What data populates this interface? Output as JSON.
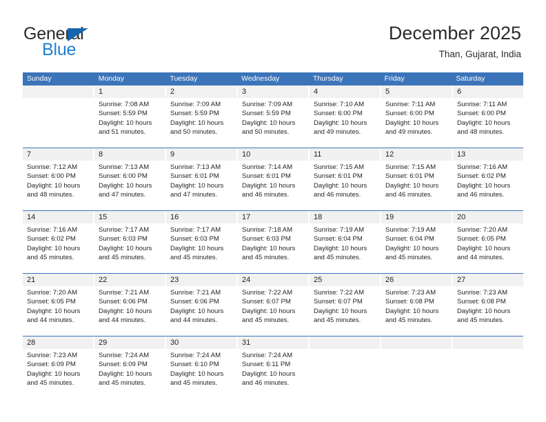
{
  "brand": {
    "name_top": "General",
    "name_bottom": "Blue",
    "accent_color": "#1f7fd0",
    "triangle_color": "#1565b0"
  },
  "header": {
    "title": "December 2025",
    "location": "Than, Gujarat, India"
  },
  "calendar": {
    "header_color": "#3c74b9",
    "day_band_color": "#f1f1f1",
    "weekday_headers": [
      "Sunday",
      "Monday",
      "Tuesday",
      "Wednesday",
      "Thursday",
      "Friday",
      "Saturday"
    ],
    "weeks": [
      [
        {
          "day": "",
          "sunrise": "",
          "sunset": "",
          "daylight_line1": "",
          "daylight_line2": ""
        },
        {
          "day": "1",
          "sunrise": "Sunrise: 7:08 AM",
          "sunset": "Sunset: 5:59 PM",
          "daylight_line1": "Daylight: 10 hours",
          "daylight_line2": "and 51 minutes."
        },
        {
          "day": "2",
          "sunrise": "Sunrise: 7:09 AM",
          "sunset": "Sunset: 5:59 PM",
          "daylight_line1": "Daylight: 10 hours",
          "daylight_line2": "and 50 minutes."
        },
        {
          "day": "3",
          "sunrise": "Sunrise: 7:09 AM",
          "sunset": "Sunset: 5:59 PM",
          "daylight_line1": "Daylight: 10 hours",
          "daylight_line2": "and 50 minutes."
        },
        {
          "day": "4",
          "sunrise": "Sunrise: 7:10 AM",
          "sunset": "Sunset: 6:00 PM",
          "daylight_line1": "Daylight: 10 hours",
          "daylight_line2": "and 49 minutes."
        },
        {
          "day": "5",
          "sunrise": "Sunrise: 7:11 AM",
          "sunset": "Sunset: 6:00 PM",
          "daylight_line1": "Daylight: 10 hours",
          "daylight_line2": "and 49 minutes."
        },
        {
          "day": "6",
          "sunrise": "Sunrise: 7:11 AM",
          "sunset": "Sunset: 6:00 PM",
          "daylight_line1": "Daylight: 10 hours",
          "daylight_line2": "and 48 minutes."
        }
      ],
      [
        {
          "day": "7",
          "sunrise": "Sunrise: 7:12 AM",
          "sunset": "Sunset: 6:00 PM",
          "daylight_line1": "Daylight: 10 hours",
          "daylight_line2": "and 48 minutes."
        },
        {
          "day": "8",
          "sunrise": "Sunrise: 7:13 AM",
          "sunset": "Sunset: 6:00 PM",
          "daylight_line1": "Daylight: 10 hours",
          "daylight_line2": "and 47 minutes."
        },
        {
          "day": "9",
          "sunrise": "Sunrise: 7:13 AM",
          "sunset": "Sunset: 6:01 PM",
          "daylight_line1": "Daylight: 10 hours",
          "daylight_line2": "and 47 minutes."
        },
        {
          "day": "10",
          "sunrise": "Sunrise: 7:14 AM",
          "sunset": "Sunset: 6:01 PM",
          "daylight_line1": "Daylight: 10 hours",
          "daylight_line2": "and 46 minutes."
        },
        {
          "day": "11",
          "sunrise": "Sunrise: 7:15 AM",
          "sunset": "Sunset: 6:01 PM",
          "daylight_line1": "Daylight: 10 hours",
          "daylight_line2": "and 46 minutes."
        },
        {
          "day": "12",
          "sunrise": "Sunrise: 7:15 AM",
          "sunset": "Sunset: 6:01 PM",
          "daylight_line1": "Daylight: 10 hours",
          "daylight_line2": "and 46 minutes."
        },
        {
          "day": "13",
          "sunrise": "Sunrise: 7:16 AM",
          "sunset": "Sunset: 6:02 PM",
          "daylight_line1": "Daylight: 10 hours",
          "daylight_line2": "and 46 minutes."
        }
      ],
      [
        {
          "day": "14",
          "sunrise": "Sunrise: 7:16 AM",
          "sunset": "Sunset: 6:02 PM",
          "daylight_line1": "Daylight: 10 hours",
          "daylight_line2": "and 45 minutes."
        },
        {
          "day": "15",
          "sunrise": "Sunrise: 7:17 AM",
          "sunset": "Sunset: 6:03 PM",
          "daylight_line1": "Daylight: 10 hours",
          "daylight_line2": "and 45 minutes."
        },
        {
          "day": "16",
          "sunrise": "Sunrise: 7:17 AM",
          "sunset": "Sunset: 6:03 PM",
          "daylight_line1": "Daylight: 10 hours",
          "daylight_line2": "and 45 minutes."
        },
        {
          "day": "17",
          "sunrise": "Sunrise: 7:18 AM",
          "sunset": "Sunset: 6:03 PM",
          "daylight_line1": "Daylight: 10 hours",
          "daylight_line2": "and 45 minutes."
        },
        {
          "day": "18",
          "sunrise": "Sunrise: 7:19 AM",
          "sunset": "Sunset: 6:04 PM",
          "daylight_line1": "Daylight: 10 hours",
          "daylight_line2": "and 45 minutes."
        },
        {
          "day": "19",
          "sunrise": "Sunrise: 7:19 AM",
          "sunset": "Sunset: 6:04 PM",
          "daylight_line1": "Daylight: 10 hours",
          "daylight_line2": "and 45 minutes."
        },
        {
          "day": "20",
          "sunrise": "Sunrise: 7:20 AM",
          "sunset": "Sunset: 6:05 PM",
          "daylight_line1": "Daylight: 10 hours",
          "daylight_line2": "and 44 minutes."
        }
      ],
      [
        {
          "day": "21",
          "sunrise": "Sunrise: 7:20 AM",
          "sunset": "Sunset: 6:05 PM",
          "daylight_line1": "Daylight: 10 hours",
          "daylight_line2": "and 44 minutes."
        },
        {
          "day": "22",
          "sunrise": "Sunrise: 7:21 AM",
          "sunset": "Sunset: 6:06 PM",
          "daylight_line1": "Daylight: 10 hours",
          "daylight_line2": "and 44 minutes."
        },
        {
          "day": "23",
          "sunrise": "Sunrise: 7:21 AM",
          "sunset": "Sunset: 6:06 PM",
          "daylight_line1": "Daylight: 10 hours",
          "daylight_line2": "and 44 minutes."
        },
        {
          "day": "24",
          "sunrise": "Sunrise: 7:22 AM",
          "sunset": "Sunset: 6:07 PM",
          "daylight_line1": "Daylight: 10 hours",
          "daylight_line2": "and 45 minutes."
        },
        {
          "day": "25",
          "sunrise": "Sunrise: 7:22 AM",
          "sunset": "Sunset: 6:07 PM",
          "daylight_line1": "Daylight: 10 hours",
          "daylight_line2": "and 45 minutes."
        },
        {
          "day": "26",
          "sunrise": "Sunrise: 7:23 AM",
          "sunset": "Sunset: 6:08 PM",
          "daylight_line1": "Daylight: 10 hours",
          "daylight_line2": "and 45 minutes."
        },
        {
          "day": "27",
          "sunrise": "Sunrise: 7:23 AM",
          "sunset": "Sunset: 6:08 PM",
          "daylight_line1": "Daylight: 10 hours",
          "daylight_line2": "and 45 minutes."
        }
      ],
      [
        {
          "day": "28",
          "sunrise": "Sunrise: 7:23 AM",
          "sunset": "Sunset: 6:09 PM",
          "daylight_line1": "Daylight: 10 hours",
          "daylight_line2": "and 45 minutes."
        },
        {
          "day": "29",
          "sunrise": "Sunrise: 7:24 AM",
          "sunset": "Sunset: 6:09 PM",
          "daylight_line1": "Daylight: 10 hours",
          "daylight_line2": "and 45 minutes."
        },
        {
          "day": "30",
          "sunrise": "Sunrise: 7:24 AM",
          "sunset": "Sunset: 6:10 PM",
          "daylight_line1": "Daylight: 10 hours",
          "daylight_line2": "and 45 minutes."
        },
        {
          "day": "31",
          "sunrise": "Sunrise: 7:24 AM",
          "sunset": "Sunset: 6:11 PM",
          "daylight_line1": "Daylight: 10 hours",
          "daylight_line2": "and 46 minutes."
        },
        {
          "day": "",
          "sunrise": "",
          "sunset": "",
          "daylight_line1": "",
          "daylight_line2": ""
        },
        {
          "day": "",
          "sunrise": "",
          "sunset": "",
          "daylight_line1": "",
          "daylight_line2": ""
        },
        {
          "day": "",
          "sunrise": "",
          "sunset": "",
          "daylight_line1": "",
          "daylight_line2": ""
        }
      ]
    ]
  }
}
